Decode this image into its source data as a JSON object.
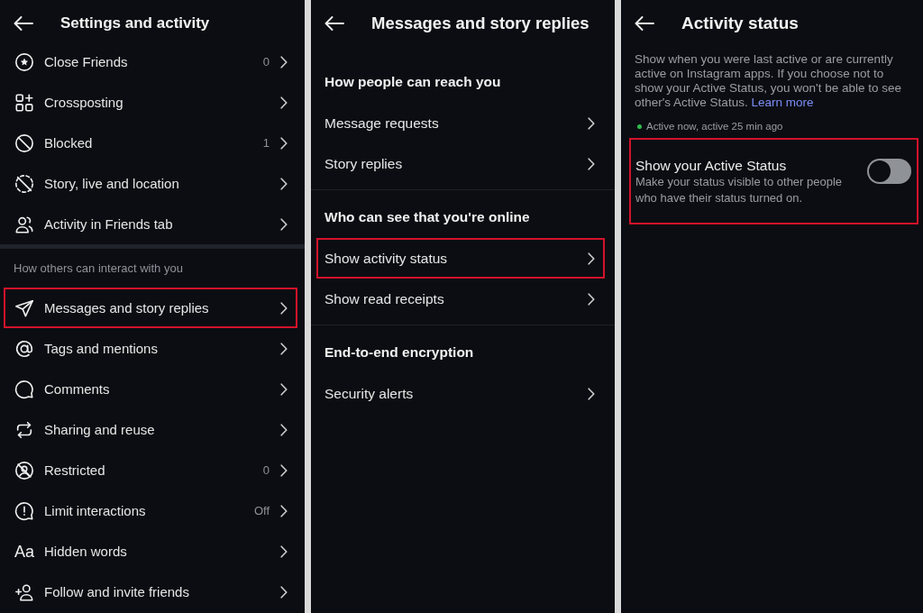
{
  "settings_panel": {
    "title": "Settings and activity",
    "groups": [
      {
        "items": [
          {
            "label": "Close Friends",
            "value": "0",
            "highlighted": false
          },
          {
            "label": "Crossposting",
            "highlighted": false
          },
          {
            "label": "Blocked",
            "value": "1",
            "highlighted": false
          },
          {
            "label": "Story, live and location",
            "highlighted": false
          },
          {
            "label": "Activity in Friends tab",
            "highlighted": false
          }
        ]
      },
      {
        "heading": "How others can interact with you",
        "items": [
          {
            "label": "Messages and story replies",
            "highlighted": true
          },
          {
            "label": "Tags and mentions",
            "highlighted": false
          },
          {
            "label": "Comments",
            "highlighted": false
          },
          {
            "label": "Sharing and reuse",
            "highlighted": false
          },
          {
            "label": "Restricted",
            "value": "0",
            "highlighted": false
          },
          {
            "label": "Limit interactions",
            "value": "Off",
            "highlighted": false
          },
          {
            "label": "Hidden words",
            "glyph": "Aa",
            "highlighted": false
          },
          {
            "label": "Follow and invite friends",
            "highlighted": false
          }
        ]
      }
    ]
  },
  "messages_panel": {
    "title": "Messages and story replies",
    "sections": [
      {
        "heading": "How people can reach you",
        "items": [
          {
            "label": "Message requests",
            "highlighted": false
          },
          {
            "label": "Story replies",
            "highlighted": false
          }
        ]
      },
      {
        "heading": "Who can see that you're online",
        "items": [
          {
            "label": "Show activity status",
            "highlighted": true
          },
          {
            "label": "Show read receipts",
            "highlighted": false
          }
        ]
      },
      {
        "heading": "End-to-end encryption",
        "items": [
          {
            "label": "Security alerts",
            "highlighted": false
          }
        ]
      }
    ]
  },
  "activity_panel": {
    "title": "Activity status",
    "description": {
      "text": "Show when you were last active or are currently active on Instagram apps. If you choose not to show your Active Status, you won't be able to see other's Active Status.",
      "link": "Learn more"
    },
    "status": {
      "text": "Active now, active 25 min ago",
      "active": true
    },
    "setting": {
      "title": "Show your Active Status",
      "description": "Make your status visible to other people who have their status turned on.",
      "on": false,
      "highlighted": true
    }
  }
}
